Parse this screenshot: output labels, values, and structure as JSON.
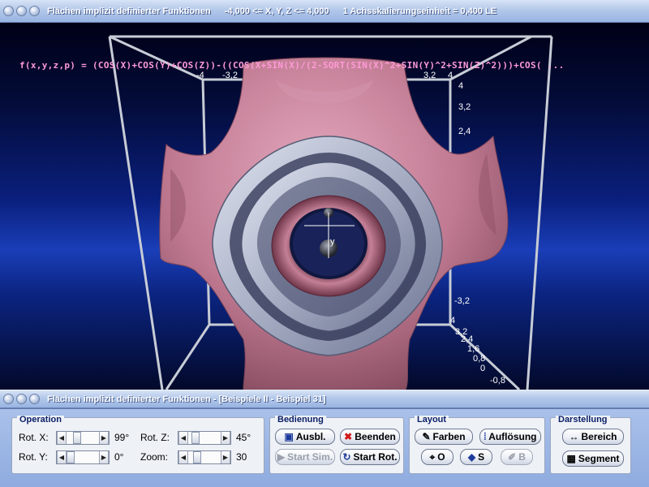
{
  "window": {
    "title": "Flächen implizit definierter Funktionen",
    "range": "-4,000 <= X, Y, Z <= 4,000",
    "scale": "1 Achsskalierungseinheit = 0,400 LE"
  },
  "viewport": {
    "formula": "f(x,y,z,p) = (COS(X)+COS(Y)+COS(Z))-((COS(X+SIN(X)/(2-SQRT(SIN(X)^2+SIN(Y)^2+SIN(Z)^2)))+COS( ...",
    "axis_label_y": "y",
    "ticks_top": [
      "-4",
      "-3,2",
      "3,2",
      "4"
    ],
    "ticks_right": [
      "4",
      "3,2",
      "2,4"
    ],
    "ticks_lower": [
      "-3,2",
      "4",
      "3,2",
      "2,4",
      "1,6",
      "0,8",
      "0",
      "-0,8"
    ],
    "colors": {
      "surface_pink": "#c07a92",
      "surface_grey": "#a7aec4",
      "background": "#0a1f7c",
      "formula": "#ff9ad8"
    }
  },
  "controls": {
    "title": "Flächen implizit definierter Funktionen - [Beispiele II - Beispiel 31]",
    "operation": {
      "title": "Operation",
      "rot_x_label": "Rot. X:",
      "rot_x_value": "99°",
      "rot_y_label": "Rot. Y:",
      "rot_y_value": "0°",
      "rot_z_label": "Rot. Z:",
      "rot_z_value": "45°",
      "zoom_label": "Zoom:",
      "zoom_value": "30"
    },
    "bedienung": {
      "title": "Bedienung",
      "ausbl": "Ausbl.",
      "beenden": "Beenden",
      "start_sim": "Start Sim.",
      "start_rot": "Start Rot."
    },
    "layout": {
      "title": "Layout",
      "farben": "Farben",
      "aufloesung": "Auflösung",
      "o": "O",
      "s": "S",
      "b": "B"
    },
    "darstellung": {
      "title": "Darstellung",
      "bereich": "Bereich",
      "segment": "Segment"
    }
  }
}
